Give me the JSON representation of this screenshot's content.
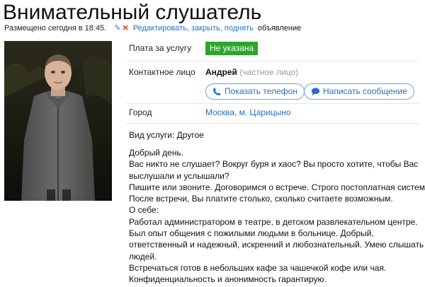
{
  "title": "Внимательный слушатель",
  "meta": {
    "posted": "Размещено сегодня в 18:45.",
    "actions": "Редактировать, закрыть, поднять",
    "suffix": "объявление"
  },
  "colors": {
    "link": "#2a6fc5",
    "price_badge": "#2ca52c",
    "delete_icon": "#e0322f"
  },
  "details": {
    "price_label": "Плата за услугу",
    "price_value": "Не указана",
    "contact_label": "Контактное лицо",
    "contact_name": "Андрей",
    "contact_kind": "(частное лицо)",
    "show_phone": "Показать телефон",
    "write_message": "Написать сообщение",
    "city_label": "Город",
    "city_value": "Москва, м. Царицыно"
  },
  "service_type": "Вид услуги: Другое",
  "description": [
    "Добрый день.",
    "Вас никто не слушает? Вокруг буря и хаос? Вы просто хотите, чтобы Вас",
    "выслушали и услышали?",
    "Пишите или звоните. Договоримся о встрече. Строго постоплатная система.",
    "После встречи, Вы платите столько, сколько считаете возможным.",
    "О себе:",
    "Работал администратором в театре, в детском развлекательном центре.",
    "Был опыт общения с пожилыми людьми в больнице. Добрый,",
    "ответственный и надежный, искренний и любознательный. Умею слышать",
    "людей.",
    "Встречаться готов в небольших кафе за чашечкой кофе или чая.",
    "Конфиденциальность и анонимность гарантирую."
  ]
}
